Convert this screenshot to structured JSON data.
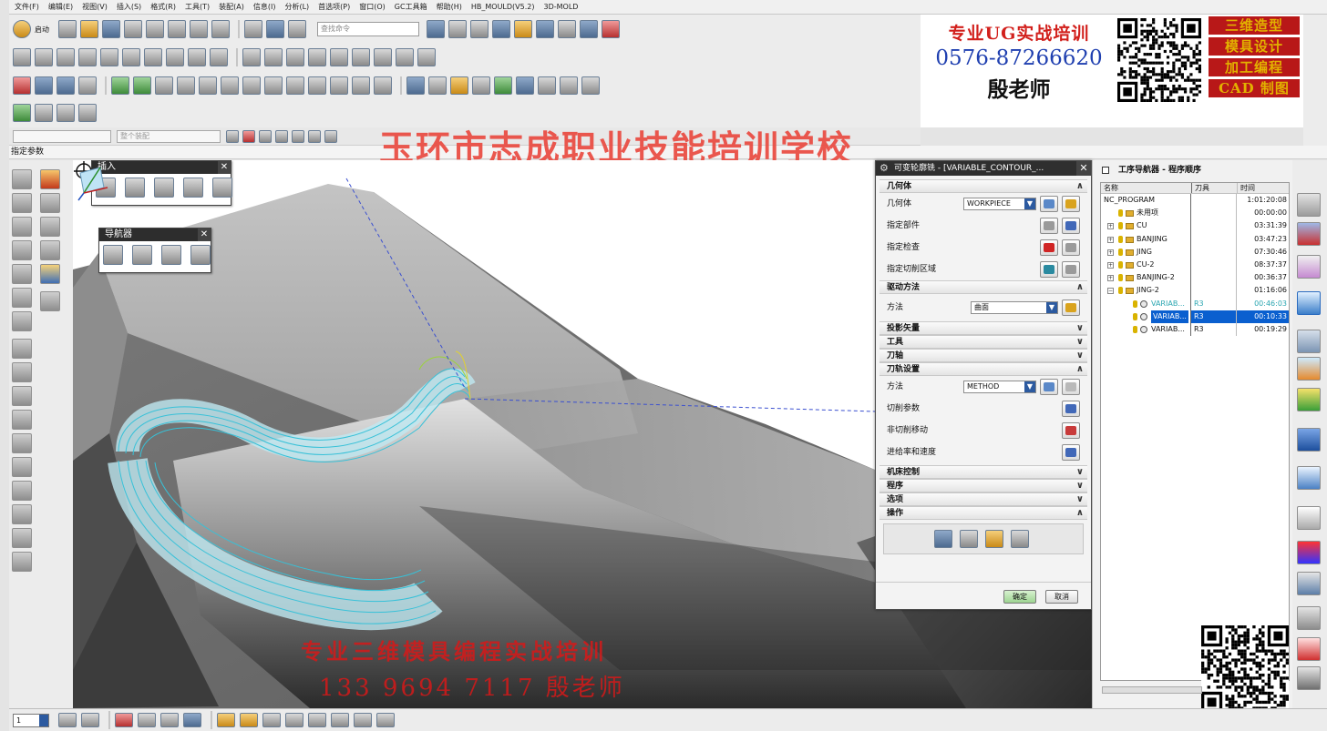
{
  "menu": [
    "文件(F)",
    "编辑(E)",
    "视图(V)",
    "插入(S)",
    "格式(R)",
    "工具(T)",
    "装配(A)",
    "信息(I)",
    "分析(L)",
    "首选项(P)",
    "窗口(O)",
    "GC工具箱",
    "帮助(H)",
    "HB_MOULD(V5.2)",
    "3D-MOLD"
  ],
  "toolbar": {
    "start_label": "启动",
    "search_placeholder": "查找命令",
    "filter_value": "整个装配"
  },
  "status_prompt": "指定参数",
  "watermark": "玉环市志成职业技能培训学校",
  "ad": {
    "title": "专业UG实战培训",
    "phone": "0576-87266620",
    "teacher": "殷老师",
    "services": [
      "三维造型",
      "模具设计",
      "加工编程",
      "CAD 制图"
    ]
  },
  "palettes": {
    "insert_title": "插入",
    "navigator_title": "导航器",
    "close_glyph": "✕"
  },
  "overlay": {
    "line1": "专业三维模具编程实战培训",
    "line2": "133 9694 7117 殷老师"
  },
  "dialog": {
    "title": "可变轮廓铣 - [VARIABLE_CONTOUR_...",
    "sections": {
      "geometry": "几何体",
      "drive_method": "驱动方法",
      "projection_vector": "投影矢量",
      "tool": "工具",
      "tool_axis": "刀轴",
      "path_settings": "刀轨设置",
      "machine_control": "机床控制",
      "program": "程序",
      "options": "选项",
      "actions": "操作"
    },
    "geometry_label": "几何体",
    "geometry_value": "WORKPIECE",
    "specify_part": "指定部件",
    "specify_check": "指定检查",
    "specify_cut_area": "指定切削区域",
    "method_label": "方法",
    "drive_value": "曲面",
    "path_method_value": "METHOD",
    "cut_params": "切削参数",
    "non_cut_moves": "非切削移动",
    "feeds_speeds": "进给率和速度",
    "ok": "确定",
    "cancel": "取消",
    "chevron_down": "∨",
    "chevron_up": "∧"
  },
  "navigator": {
    "title": "工序导航器 - 程序顺序",
    "columns": [
      "名称",
      "刀具",
      "时间"
    ],
    "rows": [
      {
        "name": "NC_PROGRAM",
        "tool": "",
        "time": "1:01:20:08"
      },
      {
        "name": "未用项",
        "tool": "",
        "time": "00:00:00"
      },
      {
        "name": "CU",
        "tool": "",
        "time": "03:31:39"
      },
      {
        "name": "BANJING",
        "tool": "",
        "time": "03:47:23"
      },
      {
        "name": "JING",
        "tool": "",
        "time": "07:30:46"
      },
      {
        "name": "CU-2",
        "tool": "",
        "time": "08:37:37"
      },
      {
        "name": "BANJING-2",
        "tool": "",
        "time": "00:36:37"
      },
      {
        "name": "JING-2",
        "tool": "",
        "time": "01:16:06"
      },
      {
        "name": "VARIAB...",
        "tool": "R3",
        "time": "00:46:03"
      },
      {
        "name": "VARIAB...",
        "tool": "R3",
        "time": "00:10:33"
      },
      {
        "name": "VARIAB...",
        "tool": "R3",
        "time": "00:19:29"
      }
    ]
  },
  "bottom": {
    "layer_value": "1"
  }
}
